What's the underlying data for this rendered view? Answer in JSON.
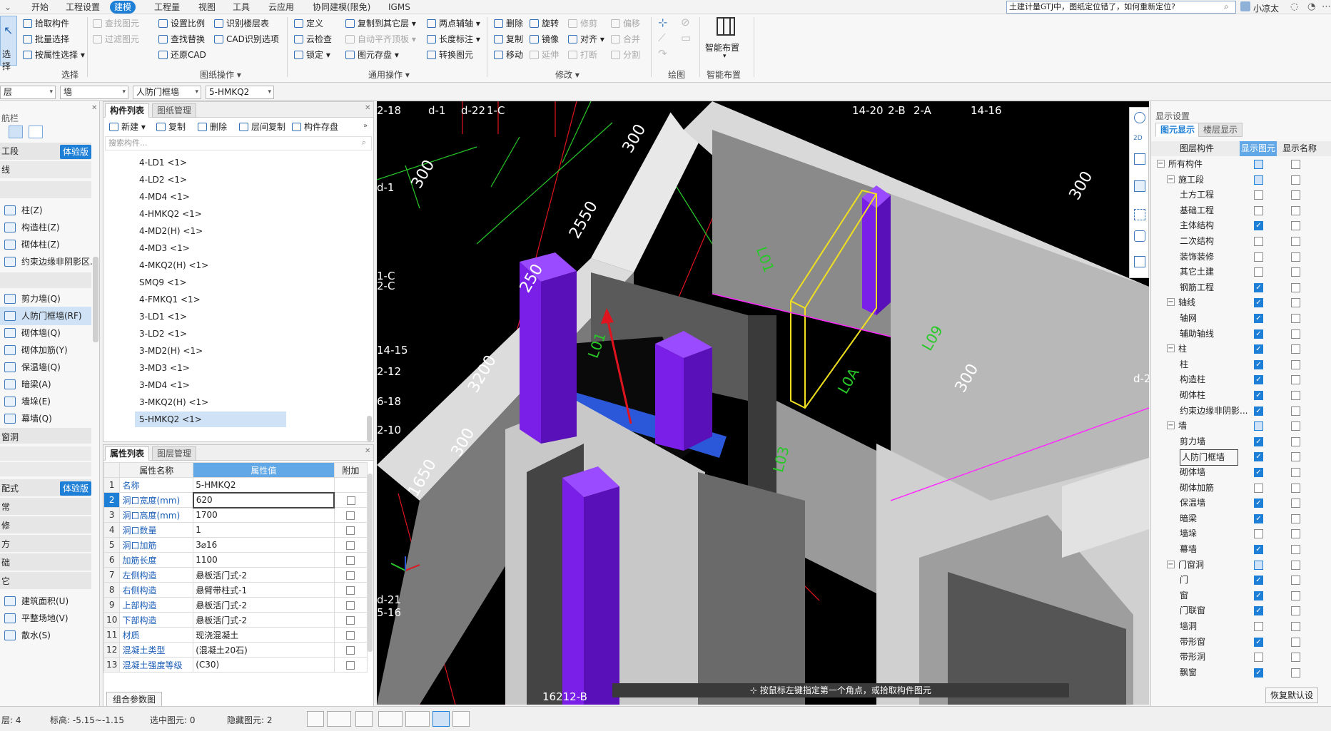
{
  "menubar": {
    "items": [
      "开始",
      "工程设置",
      "建模",
      "工程量",
      "视图",
      "工具",
      "云应用",
      "协同建模(限免)",
      "IGMS"
    ],
    "active_index": 2,
    "search_text": "土建计量GTJ中，图纸定位错了，如何重新定位?",
    "user_name": "小凉太"
  },
  "ribbon": {
    "select_group": {
      "big_button": "选择",
      "items": [
        "拾取构件",
        "批量选择",
        "按属性选择"
      ],
      "label": "选择"
    },
    "drawing_ops": {
      "items": [
        "查找图元",
        "过滤图元",
        "设置比例",
        "识别楼层表",
        "查找替换",
        "CAD识别选项",
        "还原CAD"
      ],
      "label": "图纸操作"
    },
    "common_ops": {
      "items": [
        "定义",
        "复制到其它层",
        "两点辅轴",
        "云检查",
        "自动平齐顶板",
        "长度标注",
        "锁定",
        "图元存盘",
        "转换图元"
      ],
      "label": "通用操作"
    },
    "modify": {
      "items": [
        "删除",
        "旋转",
        "修剪",
        "偏移",
        "复制",
        "镜像",
        "对齐",
        "合并",
        "移动",
        "延伸",
        "打断",
        "分割"
      ],
      "label": "修改"
    },
    "draw": {
      "label": "绘图"
    },
    "smart": {
      "big_button": "智能布置",
      "label": "智能布置"
    }
  },
  "filterbar": {
    "selects": [
      "层",
      "墙",
      "人防门框墙",
      "5-HMKQ2"
    ]
  },
  "nav": {
    "title": "航栏",
    "sections": [
      {
        "label": "工段",
        "badge": "体验版"
      },
      {
        "label": "线"
      }
    ],
    "items": [
      "柱(Z)",
      "构造柱(Z)",
      "砌体柱(Z)",
      "约束边缘非阴影区...",
      "剪力墙(Q)",
      "人防门框墙(RF)",
      "砌体墙(Q)",
      "砌体加筋(Y)",
      "保温墙(Q)",
      "暗梁(A)",
      "墙垛(E)",
      "幕墙(Q)"
    ],
    "selected_index": 5,
    "lower_groups": [
      "窗洞",
      "配式",
      "常",
      "修",
      "方",
      "础",
      "它"
    ],
    "lower_badge": "体验版",
    "lower_items": [
      "建筑面积(U)",
      "平整场地(V)",
      "散水(S)"
    ]
  },
  "component_list": {
    "tabs": [
      "构件列表",
      "图纸管理"
    ],
    "toolbar": [
      "新建",
      "复制",
      "删除",
      "层间复制",
      "构件存盘"
    ],
    "search_placeholder": "搜索构件...",
    "items": [
      "4-LD1 <1>",
      "4-LD2 <1>",
      "4-MD4 <1>",
      "4-HMKQ2 <1>",
      "4-MD2(H) <1>",
      "4-MD3 <1>",
      "4-MKQ2(H) <1>",
      "SMQ9 <1>",
      "4-FMKQ1 <1>",
      "3-LD1 <1>",
      "3-LD2 <1>",
      "3-MD2(H) <1>",
      "3-MD3 <1>",
      "3-MD4 <1>",
      "3-MKQ2(H) <1>",
      "5-HMKQ2 <1>"
    ],
    "selected_index": 15
  },
  "properties": {
    "tabs": [
      "属性列表",
      "图层管理"
    ],
    "headers": [
      "属性名称",
      "属性值",
      "附加"
    ],
    "rows": [
      {
        "n": "1",
        "k": "名称",
        "v": "5-HMKQ2"
      },
      {
        "n": "2",
        "k": "洞口宽度(mm)",
        "v": "620"
      },
      {
        "n": "3",
        "k": "洞口高度(mm)",
        "v": "1700"
      },
      {
        "n": "4",
        "k": "洞口数量",
        "v": "1"
      },
      {
        "n": "5",
        "k": "洞口加筋",
        "v": "3⌀16"
      },
      {
        "n": "6",
        "k": "加筋长度",
        "v": "1100"
      },
      {
        "n": "7",
        "k": "左侧构造",
        "v": "悬板活门式-2"
      },
      {
        "n": "8",
        "k": "右侧构造",
        "v": "悬臂带柱式-1"
      },
      {
        "n": "9",
        "k": "上部构造",
        "v": "悬板活门式-2"
      },
      {
        "n": "10",
        "k": "下部构造",
        "v": "悬板活门式-2"
      },
      {
        "n": "11",
        "k": "材质",
        "v": "现浇混凝土"
      },
      {
        "n": "12",
        "k": "混凝土类型",
        "v": "(混凝土20石)"
      },
      {
        "n": "13",
        "k": "混凝土强度等级",
        "v": "(C30)"
      }
    ],
    "combo_button": "组合参数图"
  },
  "viewport": {
    "hint": "按鼠标左键指定第一个角点，或拾取构件图元",
    "grid_labels": [
      "2-18",
      "d-1",
      "d-22",
      "1-C",
      "14-20",
      "2-B",
      "2-A",
      "14-16",
      "14-15",
      "2-12",
      "6-18",
      "2-10",
      "d-1",
      "2-C",
      "d-21",
      "5-16",
      "16212-B",
      "d-2",
      "1-C"
    ],
    "dims": [
      "300",
      "2550",
      "250",
      "3200",
      "1650",
      "300",
      "300",
      "300",
      "300"
    ],
    "beam_labels": [
      "L01",
      "L0A",
      "L03",
      "L09",
      "L01"
    ]
  },
  "display_settings": {
    "title": "显示设置",
    "tabs": [
      "图元显示",
      "楼层显示"
    ],
    "headers": [
      "图层构件",
      "显示图元",
      "显示名称"
    ],
    "rows": [
      {
        "label": "所有构件",
        "level": 0,
        "toggle": "−",
        "show": "part",
        "name": "off"
      },
      {
        "label": "施工段",
        "level": 1,
        "toggle": "−",
        "show": "part",
        "name": "off"
      },
      {
        "label": "土方工程",
        "level": 2,
        "show": "off",
        "name": "off"
      },
      {
        "label": "基础工程",
        "level": 2,
        "show": "off",
        "name": "off"
      },
      {
        "label": "主体结构",
        "level": 2,
        "show": "on",
        "name": "off"
      },
      {
        "label": "二次结构",
        "level": 2,
        "show": "off",
        "name": "off"
      },
      {
        "label": "装饰装修",
        "level": 2,
        "show": "off",
        "name": "off"
      },
      {
        "label": "其它土建",
        "level": 2,
        "show": "off",
        "name": "off"
      },
      {
        "label": "钢筋工程",
        "level": 2,
        "show": "on",
        "name": "off"
      },
      {
        "label": "轴线",
        "level": 1,
        "toggle": "−",
        "show": "on",
        "name": "off"
      },
      {
        "label": "轴网",
        "level": 2,
        "show": "on",
        "name": "off"
      },
      {
        "label": "辅助轴线",
        "level": 2,
        "show": "on",
        "name": "off"
      },
      {
        "label": "柱",
        "level": 1,
        "toggle": "−",
        "show": "on",
        "name": "off"
      },
      {
        "label": "柱",
        "level": 2,
        "show": "on",
        "name": "off"
      },
      {
        "label": "构造柱",
        "level": 2,
        "show": "on",
        "name": "off"
      },
      {
        "label": "砌体柱",
        "level": 2,
        "show": "on",
        "name": "off"
      },
      {
        "label": "约束边缘非阴影...",
        "level": 2,
        "show": "on",
        "name": "off"
      },
      {
        "label": "墙",
        "level": 1,
        "toggle": "−",
        "show": "part",
        "name": "off"
      },
      {
        "label": "剪力墙",
        "level": 2,
        "show": "on",
        "name": "off"
      },
      {
        "label": "人防门框墙",
        "level": 2,
        "show": "on",
        "name": "off",
        "sel": true
      },
      {
        "label": "砌体墙",
        "level": 2,
        "show": "on",
        "name": "off"
      },
      {
        "label": "砌体加筋",
        "level": 2,
        "show": "off",
        "name": "off"
      },
      {
        "label": "保温墙",
        "level": 2,
        "show": "on",
        "name": "off"
      },
      {
        "label": "暗梁",
        "level": 2,
        "show": "on",
        "name": "off"
      },
      {
        "label": "墙垛",
        "level": 2,
        "show": "off",
        "name": "off"
      },
      {
        "label": "幕墙",
        "level": 2,
        "show": "on",
        "name": "off"
      },
      {
        "label": "门窗洞",
        "level": 1,
        "toggle": "−",
        "show": "part",
        "name": "off"
      },
      {
        "label": "门",
        "level": 2,
        "show": "on",
        "name": "off"
      },
      {
        "label": "窗",
        "level": 2,
        "show": "on",
        "name": "off"
      },
      {
        "label": "门联窗",
        "level": 2,
        "show": "on",
        "name": "off"
      },
      {
        "label": "墙洞",
        "level": 2,
        "show": "off",
        "name": "off"
      },
      {
        "label": "带形窗",
        "level": 2,
        "show": "on",
        "name": "off"
      },
      {
        "label": "带形洞",
        "level": 2,
        "show": "off",
        "name": "off"
      },
      {
        "label": "飘窗",
        "level": 2,
        "show": "on",
        "name": "off"
      }
    ],
    "restore_button": "恢复默认设"
  },
  "status": {
    "floor": "4",
    "elevation_label": "标高:",
    "elevation": "-5.15~-1.15",
    "selected_label": "选中图元:",
    "selected": "0",
    "hidden_label": "隐藏图元:",
    "hidden": "2",
    "floor_prefix": "层:"
  },
  "colors": {
    "accent": "#1e7fd6",
    "wall_purple": "#7a1fe8",
    "grid_red": "#e0141e",
    "grid_green": "#28c828",
    "beam_yellow": "#f0e020"
  }
}
